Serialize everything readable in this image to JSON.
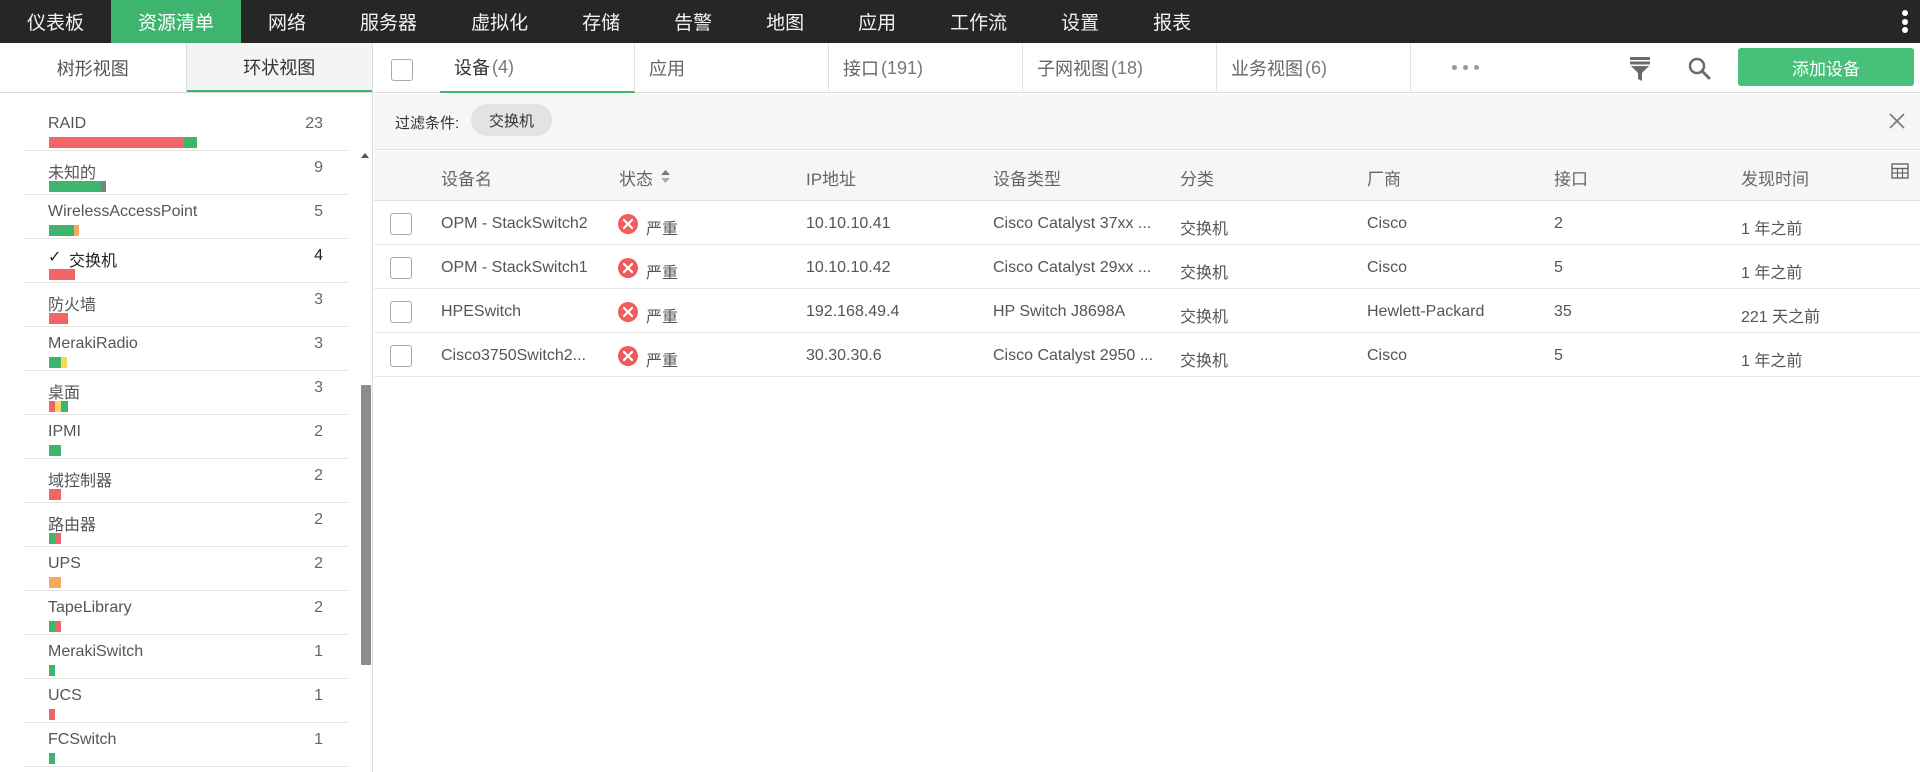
{
  "topnav": {
    "items": [
      "仪表板",
      "资源清单",
      "网络",
      "服务器",
      "虚拟化",
      "存储",
      "告警",
      "地图",
      "应用",
      "工作流",
      "设置",
      "报表"
    ],
    "active_index": 1
  },
  "left": {
    "view_tabs": [
      "树形视图",
      "环状视图"
    ],
    "active_view": 1,
    "categories": [
      {
        "name": "RAID",
        "count": "23",
        "segments": [
          [
            "#f06565",
            135
          ],
          [
            "#3db56f",
            13
          ]
        ]
      },
      {
        "name": "未知的",
        "count": "9",
        "segments": [
          [
            "#3db56f",
            52
          ],
          [
            "#808080",
            5
          ]
        ]
      },
      {
        "name": "WirelessAccessPoint",
        "count": "5",
        "segments": [
          [
            "#3db56f",
            25
          ],
          [
            "#f5a95c",
            5
          ]
        ]
      },
      {
        "name": "交换机",
        "count": "4",
        "selected": true,
        "segments": [
          [
            "#f06565",
            26
          ]
        ]
      },
      {
        "name": "防火墙",
        "count": "3",
        "segments": [
          [
            "#f06565",
            19
          ]
        ]
      },
      {
        "name": "MerakiRadio",
        "count": "3",
        "segments": [
          [
            "#3db56f",
            12
          ],
          [
            "#f5d85c",
            6
          ]
        ]
      },
      {
        "name": "桌面",
        "count": "3",
        "segments": [
          [
            "#f06565",
            6
          ],
          [
            "#f5d85c",
            6
          ],
          [
            "#3db56f",
            7
          ]
        ]
      },
      {
        "name": "IPMI",
        "count": "2",
        "segments": [
          [
            "#3db56f",
            12
          ]
        ]
      },
      {
        "name": "域控制器",
        "count": "2",
        "segments": [
          [
            "#f06565",
            12
          ]
        ]
      },
      {
        "name": "路由器",
        "count": "2",
        "segments": [
          [
            "#3db56f",
            6
          ],
          [
            "#f06565",
            6
          ]
        ]
      },
      {
        "name": "UPS",
        "count": "2",
        "segments": [
          [
            "#f5a95c",
            12
          ]
        ]
      },
      {
        "name": "TapeLibrary",
        "count": "2",
        "segments": [
          [
            "#3db56f",
            6
          ],
          [
            "#f06565",
            6
          ]
        ]
      },
      {
        "name": "MerakiSwitch",
        "count": "1",
        "segments": [
          [
            "#3db56f",
            6
          ]
        ]
      },
      {
        "name": "UCS",
        "count": "1",
        "segments": [
          [
            "#f06565",
            6
          ]
        ]
      },
      {
        "name": "FCSwitch",
        "count": "1",
        "segments": [
          [
            "#3db56f",
            6
          ]
        ]
      }
    ]
  },
  "tabs": [
    {
      "label": "设备",
      "count": "(4)",
      "active": true
    },
    {
      "label": "应用",
      "count": ""
    },
    {
      "label": "接口",
      "count": "(191)"
    },
    {
      "label": "子网视图",
      "count": "(18)"
    },
    {
      "label": "业务视图",
      "count": "(6)"
    }
  ],
  "toolbar": {
    "add_label": "添加设备",
    "filter_icon": "filter-funnel-icon",
    "search_icon": "search-icon",
    "more_icon": "more-horizontal-icon"
  },
  "filter": {
    "label": "过滤条件:",
    "chip": "交换机"
  },
  "table": {
    "columns": [
      "设备名",
      "状态",
      "IP地址",
      "设备类型",
      "分类",
      "厂商",
      "接口",
      "发现时间"
    ],
    "rows": [
      {
        "name": "OPM - StackSwitch2",
        "status": "严重",
        "ip": "10.10.10.41",
        "type": "Cisco Catalyst 37xx ...",
        "category": "交换机",
        "vendor": "Cisco",
        "interfaces": "2",
        "discovered": "1 年之前"
      },
      {
        "name": "OPM - StackSwitch1",
        "status": "严重",
        "ip": "10.10.10.42",
        "type": "Cisco Catalyst 29xx ...",
        "category": "交换机",
        "vendor": "Cisco",
        "interfaces": "5",
        "discovered": "1 年之前"
      },
      {
        "name": "HPESwitch",
        "status": "严重",
        "ip": "192.168.49.4",
        "type": "HP Switch J8698A",
        "category": "交换机",
        "vendor": "Hewlett-Packard",
        "interfaces": "35",
        "discovered": "221 天之前"
      },
      {
        "name": "Cisco3750Switch2...",
        "status": "严重",
        "ip": "30.30.30.6",
        "type": "Cisco Catalyst 2950 ...",
        "category": "交换机",
        "vendor": "Cisco",
        "interfaces": "5",
        "discovered": "1 年之前"
      }
    ]
  },
  "colors": {
    "accent": "#3db56f",
    "button": "#47c07a",
    "critical": "#ef5c5c",
    "topnav_bg": "#262626"
  }
}
